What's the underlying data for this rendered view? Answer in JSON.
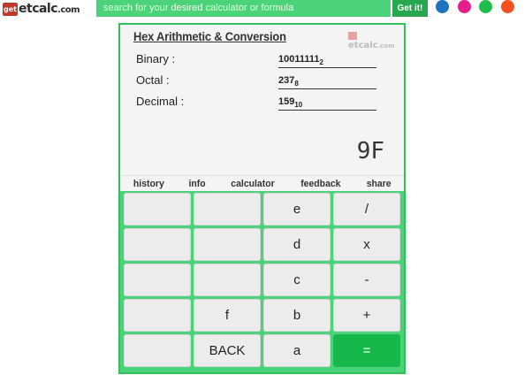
{
  "header": {
    "logo_mark": "get",
    "logo_text": "etcalc",
    "logo_dotcom": ".com",
    "search_placeholder": "search for your desired calculator or formula",
    "search_button": "Get it!"
  },
  "colors": {
    "brand_green": "#4cd37a",
    "dark_green": "#27a84f",
    "equals_green": "#16b84b",
    "dot_blue": "#1e73be",
    "dot_pink": "#e61e8c",
    "dot_green": "#1fbe4a",
    "dot_orange": "#f4511e"
  },
  "calculator": {
    "title": "Hex Arithmetic & Conversion",
    "brand": "etcalc",
    "brand_com": ".com",
    "rows": [
      {
        "label": "Binary :",
        "value": "10011111",
        "base": "2"
      },
      {
        "label": "Octal :",
        "value": "237",
        "base": "8"
      },
      {
        "label": "Decimal :",
        "value": "159",
        "base": "10"
      }
    ],
    "result": "9F",
    "tabs": [
      "history",
      "info",
      "calculator",
      "feedback",
      "share"
    ],
    "keys": [
      [
        "",
        "",
        "e",
        "/"
      ],
      [
        "",
        "",
        "d",
        "x"
      ],
      [
        "",
        "",
        "c",
        "-"
      ],
      [
        "",
        "f",
        "b",
        "+"
      ],
      [
        "",
        "BACK",
        "a",
        "="
      ]
    ]
  }
}
